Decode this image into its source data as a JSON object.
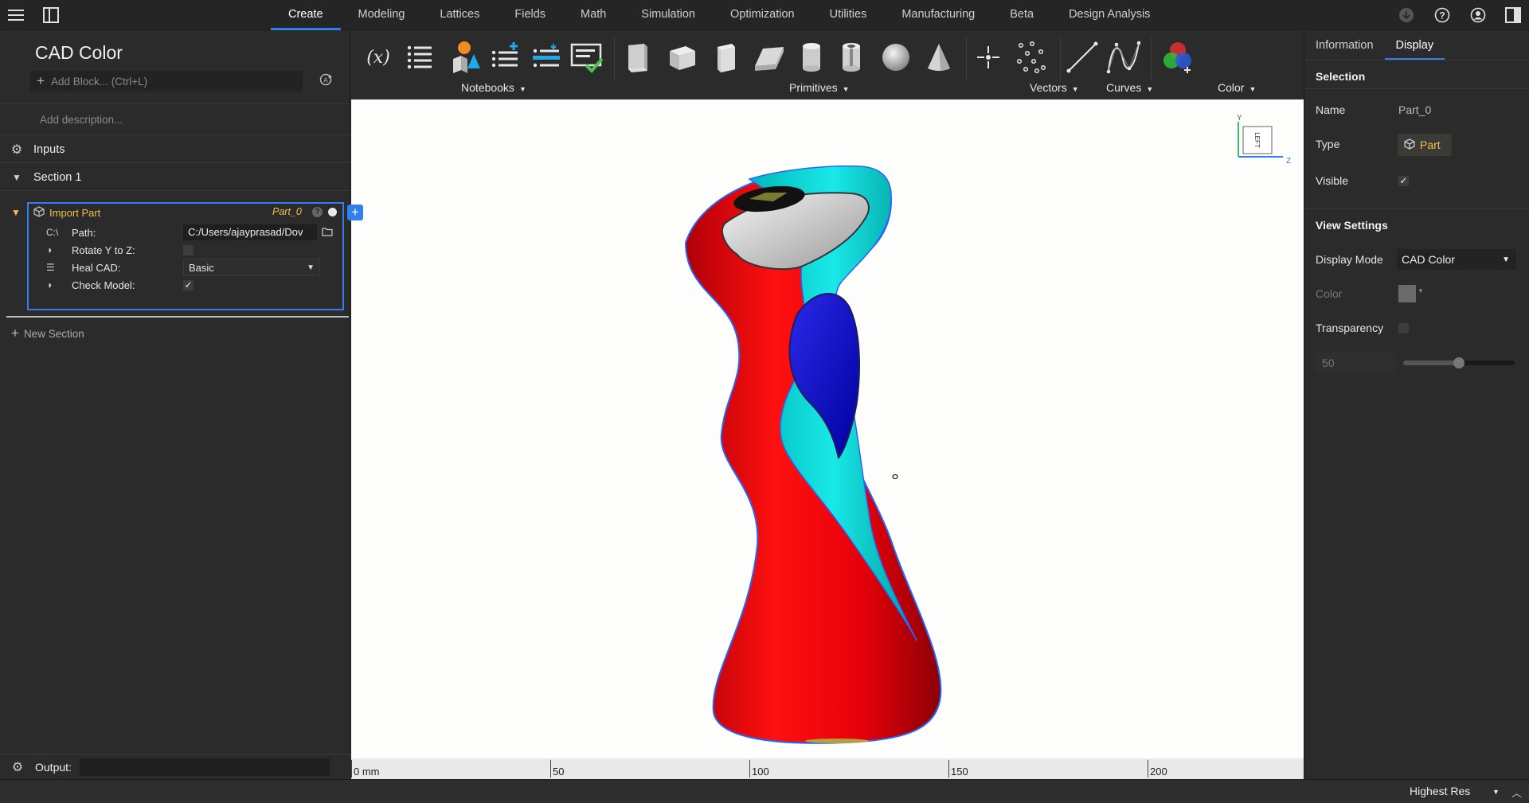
{
  "topbar": {
    "tabs": [
      "Create",
      "Modeling",
      "Lattices",
      "Fields",
      "Math",
      "Simulation",
      "Optimization",
      "Utilities",
      "Manufacturing",
      "Beta",
      "Design Analysis"
    ],
    "active_tab": "Create",
    "icons": [
      "menu-icon",
      "panel-toggle-icon",
      "download-icon",
      "help-icon",
      "account-icon",
      "right-panel-icon"
    ]
  },
  "left": {
    "title": "CAD Color",
    "add_block_placeholder": "Add Block... (Ctrl+L)",
    "description_placeholder": "Add description...",
    "inputs_label": "Inputs",
    "section_label": "Section 1",
    "block": {
      "name": "Import Part",
      "output_name": "Part_0",
      "help": "?",
      "params": {
        "path_label": "Path:",
        "path_value": "C:/Users/ajayprasad/Dov",
        "path_icon_text": "C:\\",
        "rotate_label": "Rotate Y to Z:",
        "rotate_checked": false,
        "heal_label": "Heal CAD:",
        "heal_value": "Basic",
        "check_label": "Check Model:",
        "check_checked": true,
        "check_mark": "✓"
      }
    },
    "new_section": "New Section",
    "output_label": "Output:"
  },
  "ribbon": {
    "groups": [
      {
        "label": "Notebooks"
      },
      {
        "label": "Primitives"
      },
      {
        "label": "Vectors"
      },
      {
        "label": "Curves"
      },
      {
        "label": "Color"
      }
    ],
    "variable_icon_text": "(x)"
  },
  "viewport": {
    "axes": {
      "y": "Y",
      "z": "Z"
    },
    "nav_cube_face": "LEFT",
    "ruler": [
      "0 mm",
      "50",
      "100",
      "150",
      "200"
    ]
  },
  "right": {
    "tabs": [
      "Information",
      "Display"
    ],
    "active_tab": "Display",
    "selection_title": "Selection",
    "name_label": "Name",
    "name_value": "Part_0",
    "type_label": "Type",
    "type_value": "Part",
    "visible_label": "Visible",
    "visible_mark": "✓",
    "view_settings_title": "View Settings",
    "display_mode_label": "Display Mode",
    "display_mode_value": "CAD Color",
    "color_label": "Color",
    "transparency_label": "Transparency",
    "transparency_value": "50",
    "transparency_fraction": 0.5
  },
  "status": {
    "resolution": "Highest Res"
  },
  "colors": {
    "accent": "#2f7ff0",
    "highlight": "#f2c04a",
    "model_red": "#e8000a",
    "model_cyan": "#00d4d4",
    "model_blue": "#0a0ad0"
  }
}
